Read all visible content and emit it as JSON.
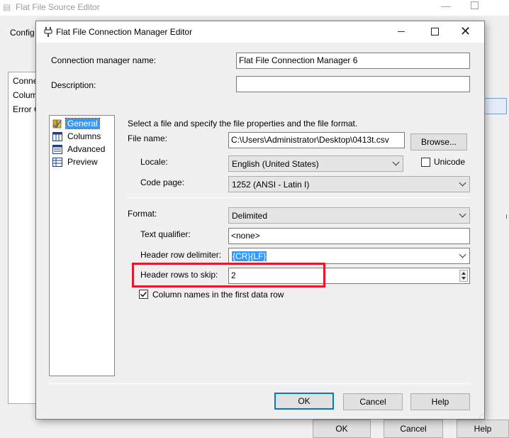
{
  "background": {
    "title": "Flat File Source Editor",
    "config_label": "Config",
    "list_items": [
      "Conne",
      "Colum",
      "Error C"
    ],
    "ok_label": "OK",
    "cancel_label": "Cancel",
    "help_label": "Help"
  },
  "dialog": {
    "title": "Flat File Connection Manager Editor",
    "connection_name_label": "Connection manager name:",
    "connection_name_value": "Flat File Connection Manager 6",
    "description_label": "Description:",
    "description_value": "",
    "nav": {
      "items": [
        {
          "label": "General",
          "icon": "general-icon",
          "selected": true
        },
        {
          "label": "Columns",
          "icon": "columns-icon",
          "selected": false
        },
        {
          "label": "Advanced",
          "icon": "advanced-icon",
          "selected": false
        },
        {
          "label": "Preview",
          "icon": "preview-icon",
          "selected": false
        }
      ]
    },
    "general": {
      "instruction": "Select a file and specify the file properties and the file format.",
      "file_name_label": "File name:",
      "file_name_value": "C:\\Users\\Administrator\\Desktop\\0413t.csv",
      "browse_label": "Browse...",
      "locale_label": "Locale:",
      "locale_value": "English (United States)",
      "unicode_label": "Unicode",
      "unicode_checked": false,
      "code_page_label": "Code page:",
      "code_page_value": "1252  (ANSI - Latin I)",
      "format_label": "Format:",
      "format_value": "Delimited",
      "text_qualifier_label": "Text qualifier:",
      "text_qualifier_value": "<none>",
      "header_row_delimiter_label": "Header row delimiter:",
      "header_row_delimiter_value": "{CR}{LF}",
      "header_rows_to_skip_label": "Header rows to skip:",
      "header_rows_to_skip_value": "2",
      "column_names_label": "Column names in the first data row",
      "column_names_checked": true
    },
    "ok_label": "OK",
    "cancel_label": "Cancel",
    "help_label": "Help"
  },
  "colors": {
    "highlight": "#e3192b",
    "selection": "#3399ff",
    "default_button_border": "#0078d7"
  }
}
